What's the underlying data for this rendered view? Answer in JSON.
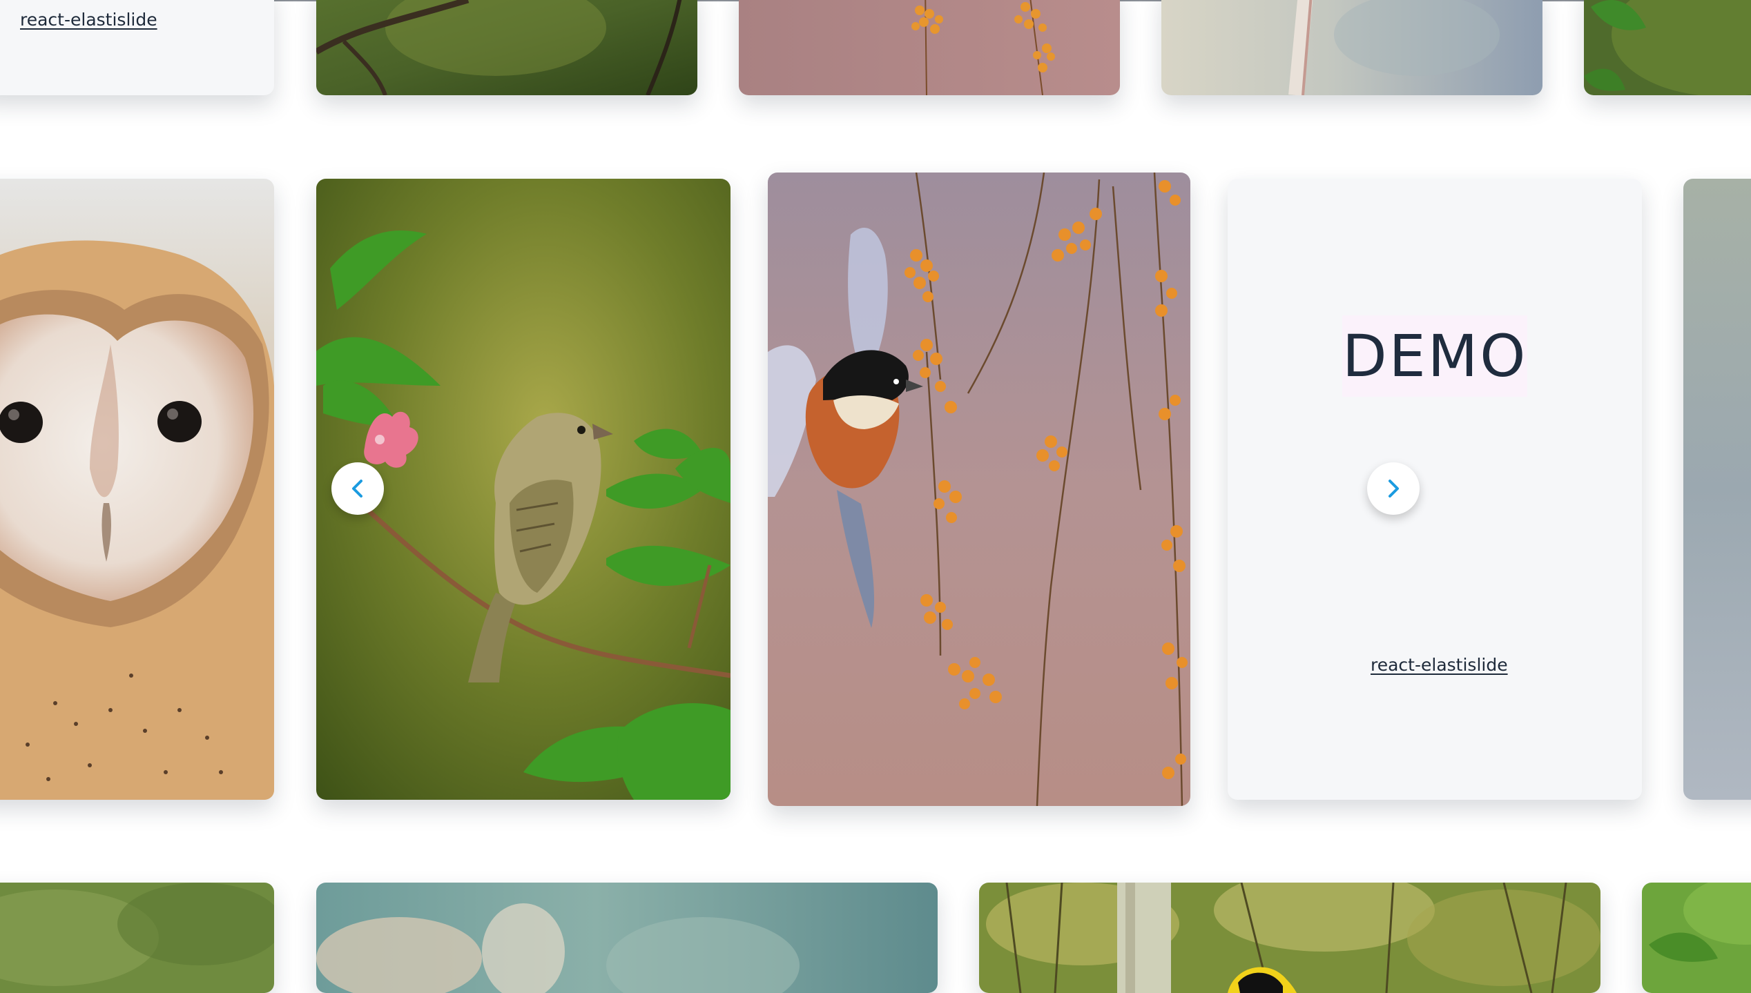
{
  "colors": {
    "accent": "#1b9be0",
    "text": "#1f2c3e",
    "demo_bg": "#fbf2fb",
    "card_bg": "#f6f7f9"
  },
  "rows": {
    "top": {
      "link_label": "react-elastislide",
      "images": [
        "branch",
        "berries",
        "pale-birch",
        "green-leaves"
      ]
    },
    "middle": {
      "images": [
        "barn-owl",
        "sparrow-on-peach-branch",
        "tit-feeding-on-berries",
        "misty-grey"
      ],
      "demo_card": {
        "title": "DEMO",
        "link_label": "react-elastislide"
      },
      "prev_icon": "chevron-left-icon",
      "next_icon": "chevron-right-icon"
    },
    "bottom": {
      "images": [
        "green-foliage",
        "misty-teal",
        "forest-toucan",
        "bright-green"
      ]
    }
  }
}
